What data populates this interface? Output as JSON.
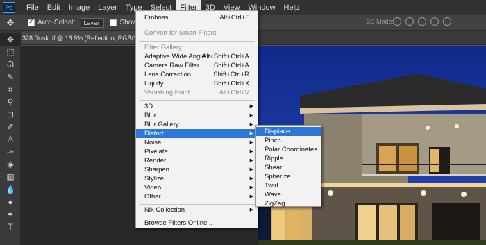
{
  "app": {
    "logo": "Ps"
  },
  "menubar": {
    "items": [
      "File",
      "Edit",
      "Image",
      "Layer",
      "Type",
      "Select",
      "Filter",
      "3D",
      "View",
      "Window",
      "Help"
    ]
  },
  "options": {
    "auto_select_label": "Auto-Select:",
    "layer_select_value": "Layer",
    "show_transform_label": "Show Tra",
    "mode_3d_label": "3D Mode:"
  },
  "tools": [
    "move-tool-icon",
    "marquee-tool-icon",
    "lasso-tool-icon",
    "quick-select-tool-icon",
    "crop-tool-icon",
    "eyedropper-tool-icon",
    "healing-brush-tool-icon",
    "brush-tool-icon",
    "clone-stamp-tool-icon",
    "history-brush-tool-icon",
    "eraser-tool-icon",
    "gradient-tool-icon",
    "blur-tool-icon",
    "dodge-tool-icon",
    "pen-tool-icon",
    "type-tool-icon"
  ],
  "document": {
    "tab_title": "328 Dusk.tif @ 18.9% (Reflection, RGB/16) *"
  },
  "filter_menu": {
    "top": [
      {
        "label": "Emboss",
        "shortcut": "Alt+Ctrl+F",
        "disabled": false
      }
    ],
    "smart": [
      {
        "label": "Convert for Smart Filters",
        "disabled": true
      }
    ],
    "group1": [
      {
        "label": "Filter Gallery...",
        "shortcut": "",
        "disabled": true
      },
      {
        "label": "Adaptive Wide Angle...",
        "shortcut": "Alt+Shift+Ctrl+A",
        "disabled": false
      },
      {
        "label": "Camera Raw Filter...",
        "shortcut": "Shift+Ctrl+A",
        "disabled": false
      },
      {
        "label": "Lens Correction...",
        "shortcut": "Shift+Ctrl+R",
        "disabled": false
      },
      {
        "label": "Liquify...",
        "shortcut": "Shift+Ctrl+X",
        "disabled": false
      },
      {
        "label": "Vanishing Point...",
        "shortcut": "Alt+Ctrl+V",
        "disabled": true
      }
    ],
    "submenus": [
      {
        "label": "3D",
        "selected": false
      },
      {
        "label": "Blur",
        "selected": false
      },
      {
        "label": "Blur Gallery",
        "selected": false
      },
      {
        "label": "Distort",
        "selected": true
      },
      {
        "label": "Noise",
        "selected": false
      },
      {
        "label": "Pixelate",
        "selected": false
      },
      {
        "label": "Render",
        "selected": false
      },
      {
        "label": "Sharpen",
        "selected": false
      },
      {
        "label": "Stylize",
        "selected": false
      },
      {
        "label": "Video",
        "selected": false
      },
      {
        "label": "Other",
        "selected": false
      }
    ],
    "plugins": [
      {
        "label": "Nik Collection"
      }
    ],
    "browse": {
      "label": "Browse Filters Online..."
    }
  },
  "distort_menu": {
    "items": [
      {
        "label": "Displace...",
        "selected": true
      },
      {
        "label": "Pinch...",
        "selected": false
      },
      {
        "label": "Polar Coordinates...",
        "selected": false
      },
      {
        "label": "Ripple...",
        "selected": false
      },
      {
        "label": "Shear...",
        "selected": false
      },
      {
        "label": "Spherize...",
        "selected": false
      },
      {
        "label": "Twirl...",
        "selected": false
      },
      {
        "label": "Wave...",
        "selected": false
      },
      {
        "label": "ZigZag...",
        "selected": false
      }
    ]
  }
}
